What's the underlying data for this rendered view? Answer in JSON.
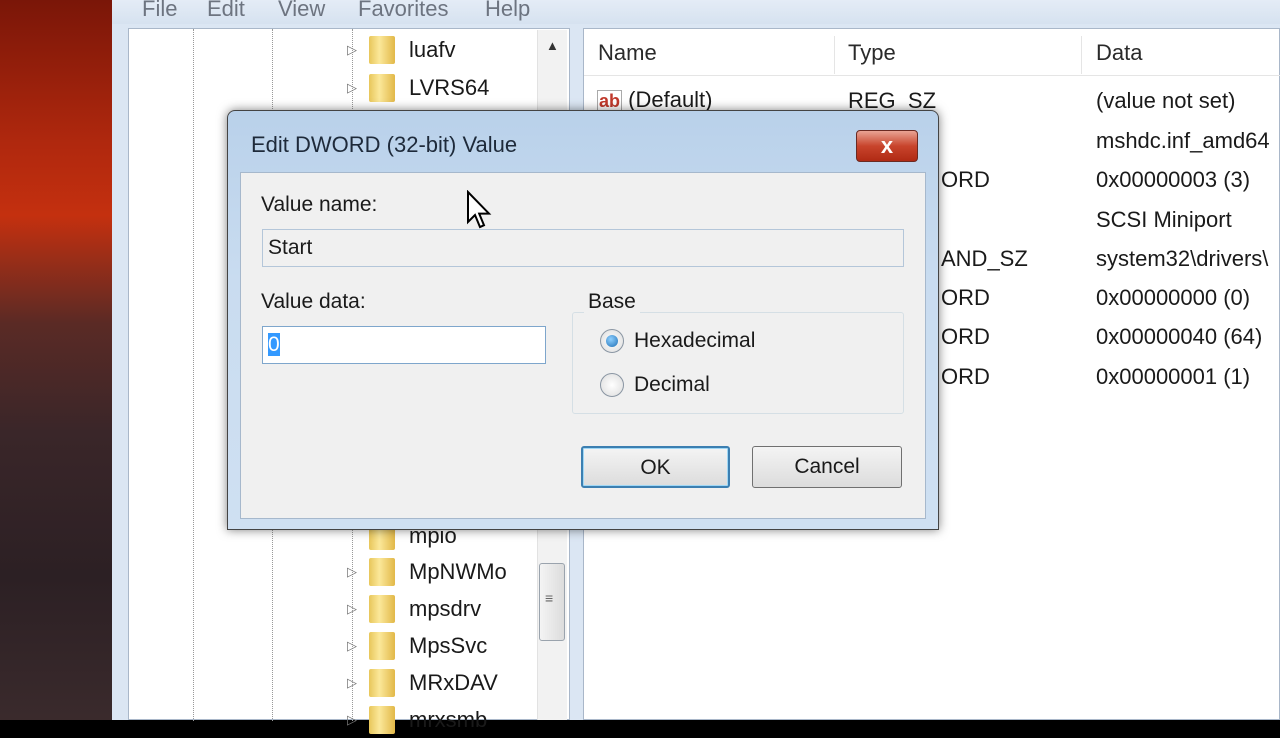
{
  "menu": [
    "File",
    "Edit",
    "View",
    "Favorites",
    "Help"
  ],
  "tree": {
    "items_top": [
      "luafv",
      "LVRS64"
    ],
    "items_bottom": [
      "mpio",
      "MpNWMo",
      "mpsdrv",
      "MpsSvc",
      "MRxDAV",
      "mrxsmb"
    ]
  },
  "list": {
    "headers": {
      "name": "Name",
      "type": "Type",
      "data": "Data"
    },
    "rows": [
      {
        "name": "(Default)",
        "type": "REG_SZ",
        "data": "(value not set)"
      },
      {
        "type": "",
        "data": "mshdc.inf_amd64"
      },
      {
        "type": "ORD",
        "data": "0x00000003 (3)"
      },
      {
        "type": "",
        "data": "SCSI Miniport"
      },
      {
        "type": "AND_SZ",
        "data": "system32\\drivers\\"
      },
      {
        "type": "ORD",
        "data": "0x00000000 (0)"
      },
      {
        "type": "ORD",
        "data": "0x00000040 (64)"
      },
      {
        "type": "ORD",
        "data": "0x00000001 (1)"
      }
    ]
  },
  "dialog": {
    "title": "Edit DWORD (32-bit) Value",
    "close": "x",
    "value_name_label": "Value name:",
    "value_name": "Start",
    "value_data_label": "Value data:",
    "value_data": "0",
    "base_label": "Base",
    "hex_label": "Hexadecimal",
    "dec_label": "Decimal",
    "ok": "OK",
    "cancel": "Cancel"
  }
}
